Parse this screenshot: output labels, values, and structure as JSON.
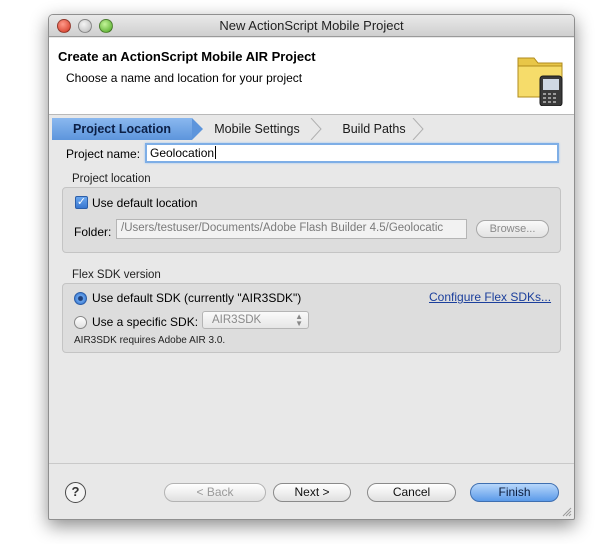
{
  "window": {
    "title": "New ActionScript Mobile Project"
  },
  "header": {
    "title": "Create an ActionScript Mobile AIR Project",
    "subtitle": "Choose a name and location for your project",
    "icon": "folder-device-icon"
  },
  "steps": [
    {
      "label": "Project Location",
      "active": true
    },
    {
      "label": "Mobile Settings",
      "active": false
    },
    {
      "label": "Build Paths",
      "active": false
    }
  ],
  "project_name": {
    "label": "Project name:",
    "value": "Geolocation"
  },
  "location": {
    "group_title": "Project location",
    "use_default_label": "Use default location",
    "use_default_checked": true,
    "folder_label": "Folder:",
    "folder_value": "/Users/testuser/Documents/Adobe Flash Builder 4.5/Geolocatic",
    "browse_label": "Browse..."
  },
  "sdk": {
    "group_title": "Flex SDK version",
    "default_label": "Use default SDK (currently \"AIR3SDK\")",
    "specific_label": "Use a specific SDK:",
    "specific_value": "AIR3SDK",
    "configure_link": "Configure Flex SDKs...",
    "note": "AIR3SDK requires Adobe AIR 3.0.",
    "selected": "default"
  },
  "buttons": {
    "back": "< Back",
    "next": "Next >",
    "cancel": "Cancel",
    "finish": "Finish",
    "help": "?"
  },
  "colors": {
    "accent": "#5d95dc",
    "link": "#1b3f9c",
    "focus": "#7eaee6"
  }
}
